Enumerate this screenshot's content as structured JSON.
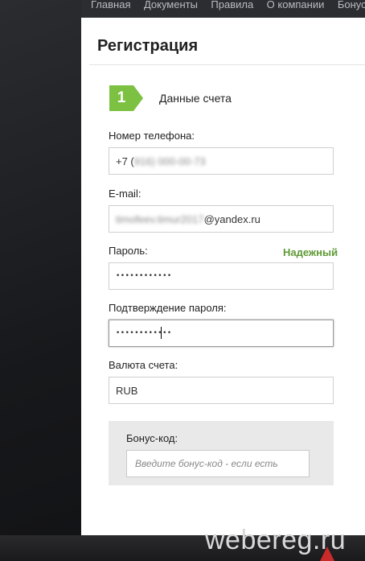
{
  "topnav": {
    "items": [
      "Главная",
      "Документы",
      "Правила",
      "О компании",
      "Бонусы"
    ]
  },
  "form": {
    "title": "Регистрация",
    "step": {
      "number": "1",
      "label": "Данные счета"
    },
    "phone": {
      "label": "Номер телефона:",
      "prefix": "+7 (",
      "masked": "916) 000-00-73"
    },
    "email": {
      "label": "E-mail:",
      "masked": "timofeev.timur2017",
      "suffix": "@yandex.ru"
    },
    "password": {
      "label": "Пароль:",
      "value": "••••••••••••",
      "strength": "Надежный"
    },
    "password_confirm": {
      "label": "Подтверждение пароля:",
      "value": "••••••••••••"
    },
    "currency": {
      "label": "Валюта счета:",
      "value": "RUB"
    },
    "bonus": {
      "label": "Бонус-код:",
      "placeholder": "Введите бонус-код - если есть"
    }
  },
  "watermark": "webereg.ru",
  "colors": {
    "accent_green": "#7cc142",
    "strength_green": "#5e9a34",
    "nav_bg": "#2c2d31"
  }
}
